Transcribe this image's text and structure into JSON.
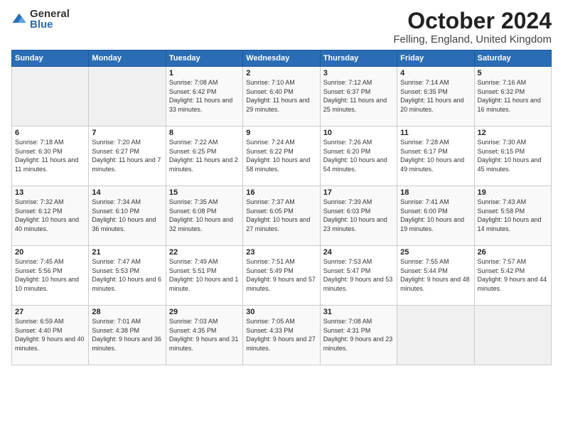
{
  "logo": {
    "general": "General",
    "blue": "Blue"
  },
  "header": {
    "month": "October 2024",
    "location": "Felling, England, United Kingdom"
  },
  "days_header": [
    "Sunday",
    "Monday",
    "Tuesday",
    "Wednesday",
    "Thursday",
    "Friday",
    "Saturday"
  ],
  "weeks": [
    [
      {
        "day": "",
        "empty": true
      },
      {
        "day": "",
        "empty": true
      },
      {
        "day": "1",
        "sunrise": "Sunrise: 7:08 AM",
        "sunset": "Sunset: 6:42 PM",
        "daylight": "Daylight: 11 hours and 33 minutes."
      },
      {
        "day": "2",
        "sunrise": "Sunrise: 7:10 AM",
        "sunset": "Sunset: 6:40 PM",
        "daylight": "Daylight: 11 hours and 29 minutes."
      },
      {
        "day": "3",
        "sunrise": "Sunrise: 7:12 AM",
        "sunset": "Sunset: 6:37 PM",
        "daylight": "Daylight: 11 hours and 25 minutes."
      },
      {
        "day": "4",
        "sunrise": "Sunrise: 7:14 AM",
        "sunset": "Sunset: 6:35 PM",
        "daylight": "Daylight: 11 hours and 20 minutes."
      },
      {
        "day": "5",
        "sunrise": "Sunrise: 7:16 AM",
        "sunset": "Sunset: 6:32 PM",
        "daylight": "Daylight: 11 hours and 16 minutes."
      }
    ],
    [
      {
        "day": "6",
        "sunrise": "Sunrise: 7:18 AM",
        "sunset": "Sunset: 6:30 PM",
        "daylight": "Daylight: 11 hours and 11 minutes."
      },
      {
        "day": "7",
        "sunrise": "Sunrise: 7:20 AM",
        "sunset": "Sunset: 6:27 PM",
        "daylight": "Daylight: 11 hours and 7 minutes."
      },
      {
        "day": "8",
        "sunrise": "Sunrise: 7:22 AM",
        "sunset": "Sunset: 6:25 PM",
        "daylight": "Daylight: 11 hours and 2 minutes."
      },
      {
        "day": "9",
        "sunrise": "Sunrise: 7:24 AM",
        "sunset": "Sunset: 6:22 PM",
        "daylight": "Daylight: 10 hours and 58 minutes."
      },
      {
        "day": "10",
        "sunrise": "Sunrise: 7:26 AM",
        "sunset": "Sunset: 6:20 PM",
        "daylight": "Daylight: 10 hours and 54 minutes."
      },
      {
        "day": "11",
        "sunrise": "Sunrise: 7:28 AM",
        "sunset": "Sunset: 6:17 PM",
        "daylight": "Daylight: 10 hours and 49 minutes."
      },
      {
        "day": "12",
        "sunrise": "Sunrise: 7:30 AM",
        "sunset": "Sunset: 6:15 PM",
        "daylight": "Daylight: 10 hours and 45 minutes."
      }
    ],
    [
      {
        "day": "13",
        "sunrise": "Sunrise: 7:32 AM",
        "sunset": "Sunset: 6:12 PM",
        "daylight": "Daylight: 10 hours and 40 minutes."
      },
      {
        "day": "14",
        "sunrise": "Sunrise: 7:34 AM",
        "sunset": "Sunset: 6:10 PM",
        "daylight": "Daylight: 10 hours and 36 minutes."
      },
      {
        "day": "15",
        "sunrise": "Sunrise: 7:35 AM",
        "sunset": "Sunset: 6:08 PM",
        "daylight": "Daylight: 10 hours and 32 minutes."
      },
      {
        "day": "16",
        "sunrise": "Sunrise: 7:37 AM",
        "sunset": "Sunset: 6:05 PM",
        "daylight": "Daylight: 10 hours and 27 minutes."
      },
      {
        "day": "17",
        "sunrise": "Sunrise: 7:39 AM",
        "sunset": "Sunset: 6:03 PM",
        "daylight": "Daylight: 10 hours and 23 minutes."
      },
      {
        "day": "18",
        "sunrise": "Sunrise: 7:41 AM",
        "sunset": "Sunset: 6:00 PM",
        "daylight": "Daylight: 10 hours and 19 minutes."
      },
      {
        "day": "19",
        "sunrise": "Sunrise: 7:43 AM",
        "sunset": "Sunset: 5:58 PM",
        "daylight": "Daylight: 10 hours and 14 minutes."
      }
    ],
    [
      {
        "day": "20",
        "sunrise": "Sunrise: 7:45 AM",
        "sunset": "Sunset: 5:56 PM",
        "daylight": "Daylight: 10 hours and 10 minutes."
      },
      {
        "day": "21",
        "sunrise": "Sunrise: 7:47 AM",
        "sunset": "Sunset: 5:53 PM",
        "daylight": "Daylight: 10 hours and 6 minutes."
      },
      {
        "day": "22",
        "sunrise": "Sunrise: 7:49 AM",
        "sunset": "Sunset: 5:51 PM",
        "daylight": "Daylight: 10 hours and 1 minute."
      },
      {
        "day": "23",
        "sunrise": "Sunrise: 7:51 AM",
        "sunset": "Sunset: 5:49 PM",
        "daylight": "Daylight: 9 hours and 57 minutes."
      },
      {
        "day": "24",
        "sunrise": "Sunrise: 7:53 AM",
        "sunset": "Sunset: 5:47 PM",
        "daylight": "Daylight: 9 hours and 53 minutes."
      },
      {
        "day": "25",
        "sunrise": "Sunrise: 7:55 AM",
        "sunset": "Sunset: 5:44 PM",
        "daylight": "Daylight: 9 hours and 48 minutes."
      },
      {
        "day": "26",
        "sunrise": "Sunrise: 7:57 AM",
        "sunset": "Sunset: 5:42 PM",
        "daylight": "Daylight: 9 hours and 44 minutes."
      }
    ],
    [
      {
        "day": "27",
        "sunrise": "Sunrise: 6:59 AM",
        "sunset": "Sunset: 4:40 PM",
        "daylight": "Daylight: 9 hours and 40 minutes."
      },
      {
        "day": "28",
        "sunrise": "Sunrise: 7:01 AM",
        "sunset": "Sunset: 4:38 PM",
        "daylight": "Daylight: 9 hours and 36 minutes."
      },
      {
        "day": "29",
        "sunrise": "Sunrise: 7:03 AM",
        "sunset": "Sunset: 4:35 PM",
        "daylight": "Daylight: 9 hours and 31 minutes."
      },
      {
        "day": "30",
        "sunrise": "Sunrise: 7:05 AM",
        "sunset": "Sunset: 4:33 PM",
        "daylight": "Daylight: 9 hours and 27 minutes."
      },
      {
        "day": "31",
        "sunrise": "Sunrise: 7:08 AM",
        "sunset": "Sunset: 4:31 PM",
        "daylight": "Daylight: 9 hours and 23 minutes."
      },
      {
        "day": "",
        "empty": true
      },
      {
        "day": "",
        "empty": true
      }
    ]
  ]
}
